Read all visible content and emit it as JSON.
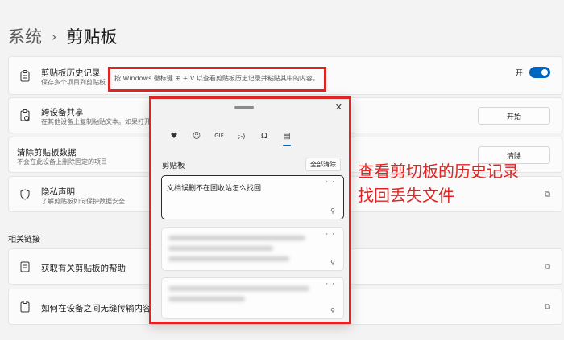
{
  "breadcrumb": {
    "parent": "系统",
    "separator": "›",
    "current": "剪贴板"
  },
  "history": {
    "title": "剪贴板历史记录",
    "desc": "保存多个项目到剪贴板",
    "toggle_label": "开"
  },
  "cross_device": {
    "title": "跨设备共享",
    "desc": "在其他设备上复制粘贴文本。如果打开了你",
    "button": "开始"
  },
  "clear_data": {
    "title": "清除剪贴板数据",
    "desc": "不会在此设备上删除固定的项目",
    "button": "清除"
  },
  "privacy": {
    "title": "隐私声明",
    "desc": "了解剪贴板如何保护数据安全"
  },
  "related_title": "相关链接",
  "link1": {
    "title": "获取有关剪贴板的帮助"
  },
  "link2": {
    "title": "如何在设备之间无缝传输内容"
  },
  "hint_text": "按 Windows 徽标键 ⊞ + V 以查看剪贴板历史记录并粘贴其中的内容。",
  "panel": {
    "close": "✕",
    "tabs": [
      "♥",
      "☺",
      "GIF",
      ";-)",
      "Ω",
      "▤"
    ],
    "label": "剪贴板",
    "clear_all": "全部清除",
    "items": [
      {
        "text": "文档误删不在回收站怎么找回",
        "more": "···",
        "pin": "⚲"
      },
      {
        "text": "",
        "more": "···",
        "pin": "⚲"
      },
      {
        "text": "",
        "more": "···",
        "pin": "⚲"
      }
    ]
  },
  "annotation": {
    "line1": "查看剪切板的历史记录",
    "line2": "找回丢失文件"
  },
  "colors": {
    "accent": "#0067c0",
    "highlight": "#e02424",
    "background": "#f3f3f3"
  }
}
